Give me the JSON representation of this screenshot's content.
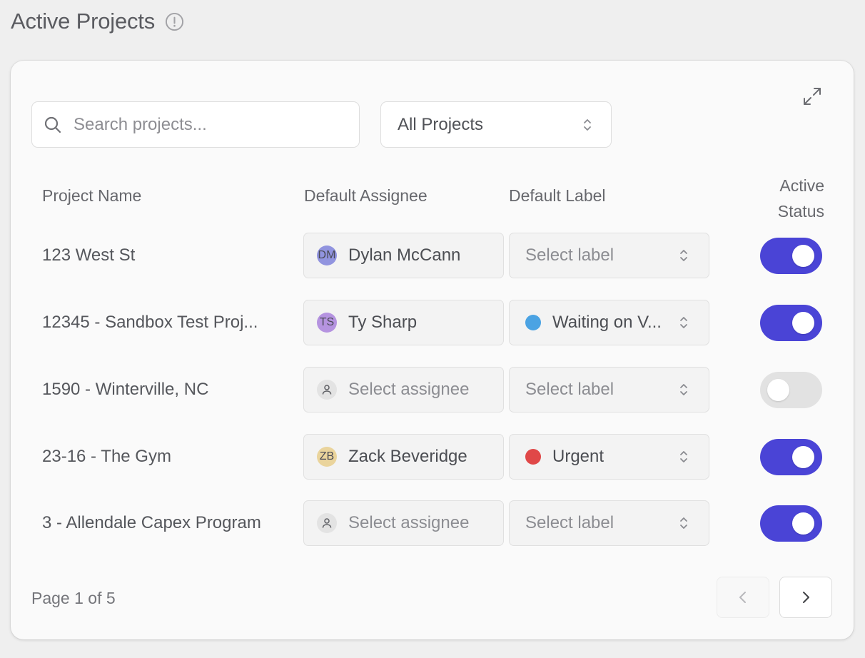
{
  "header": {
    "title": "Active Projects",
    "info_icon": "info-circle-icon"
  },
  "toolbar": {
    "search_placeholder": "Search projects...",
    "filter_value": "All Projects",
    "expand_icon": "expand-icon"
  },
  "columns": {
    "project_name": "Project Name",
    "default_assignee": "Default Assignee",
    "default_label": "Default Label",
    "active_status_line1": "Active",
    "active_status_line2": "Status"
  },
  "rows": [
    {
      "name": "123 West St",
      "assignee": "Dylan McCann",
      "assignee_initials": "DM",
      "label": "Select label",
      "label_color": null,
      "active": true
    },
    {
      "name": "12345 - Sandbox Test Proj...",
      "assignee": "Ty Sharp",
      "assignee_initials": "TS",
      "label": "Waiting on V...",
      "label_color": "#4ba3e3",
      "active": true
    },
    {
      "name": "1590 - Winterville, NC",
      "assignee": "Select assignee",
      "assignee_initials": "",
      "label": "Select label",
      "label_color": null,
      "active": false
    },
    {
      "name": "23-16 - The Gym",
      "assignee": "Zack Beveridge",
      "assignee_initials": "ZB",
      "label": "Urgent",
      "label_color": "#e04848",
      "active": true
    },
    {
      "name": "3 - Allendale Capex Program",
      "assignee": "Select assignee",
      "assignee_initials": "",
      "label": "Select label",
      "label_color": null,
      "active": true
    }
  ],
  "pagination": {
    "text": "Page 1 of 5"
  },
  "colors": {
    "toggle_on": "#4a44d6",
    "toggle_off": "#e2e2e2"
  }
}
